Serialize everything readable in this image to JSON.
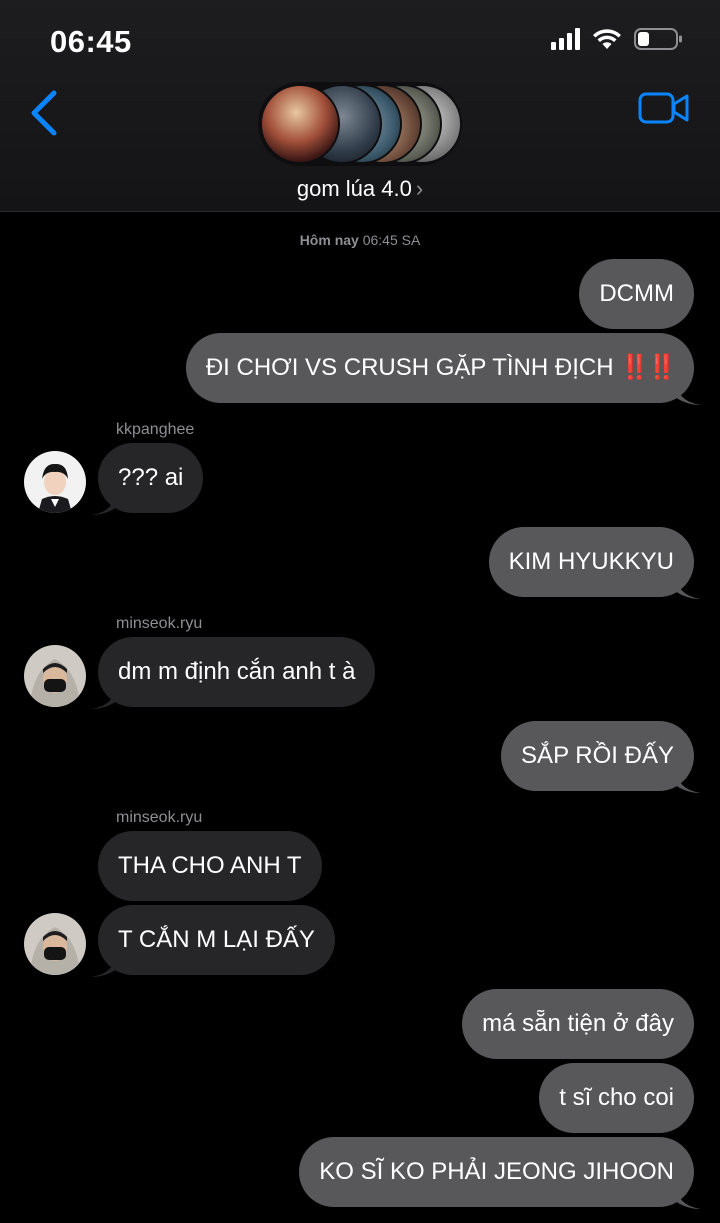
{
  "status_bar": {
    "time": "06:45"
  },
  "header": {
    "group_name": "gom lúa 4.0",
    "chevron": "›"
  },
  "timestamp": {
    "day": "Hôm nay",
    "time": "06:45 SA"
  },
  "messages": [
    {
      "text": "DCMM"
    },
    {
      "text": "ĐI CHƠI VS CRUSH GẶP TÌNH ĐỊCH",
      "emoji": "‼️‼️"
    },
    {
      "sender": "kkpanghee",
      "text": "??? ai"
    },
    {
      "text": "KIM HYUKKYU"
    },
    {
      "sender": "minseok.ryu",
      "text": "dm m định cắn anh t à"
    },
    {
      "text": "SẮP RỒI ĐẤY"
    },
    {
      "sender": "minseok.ryu",
      "text": "THA CHO ANH T"
    },
    {
      "text": "T CẮN M LẠI ĐẤY"
    },
    {
      "text": "má sẵn tiện ở đây"
    },
    {
      "text": "t sĩ cho coi"
    },
    {
      "text": "KO SĨ KO PHẢI JEONG JIHOON"
    }
  ],
  "colors": {
    "accent": "#0a84ff",
    "sent_bubble": "#58585b",
    "received_bubble": "#262629",
    "emoji_red": "#e0251b"
  },
  "icons": [
    "cellular-signal-icon",
    "wifi-icon",
    "battery-icon",
    "back-chevron-icon",
    "video-call-icon"
  ]
}
